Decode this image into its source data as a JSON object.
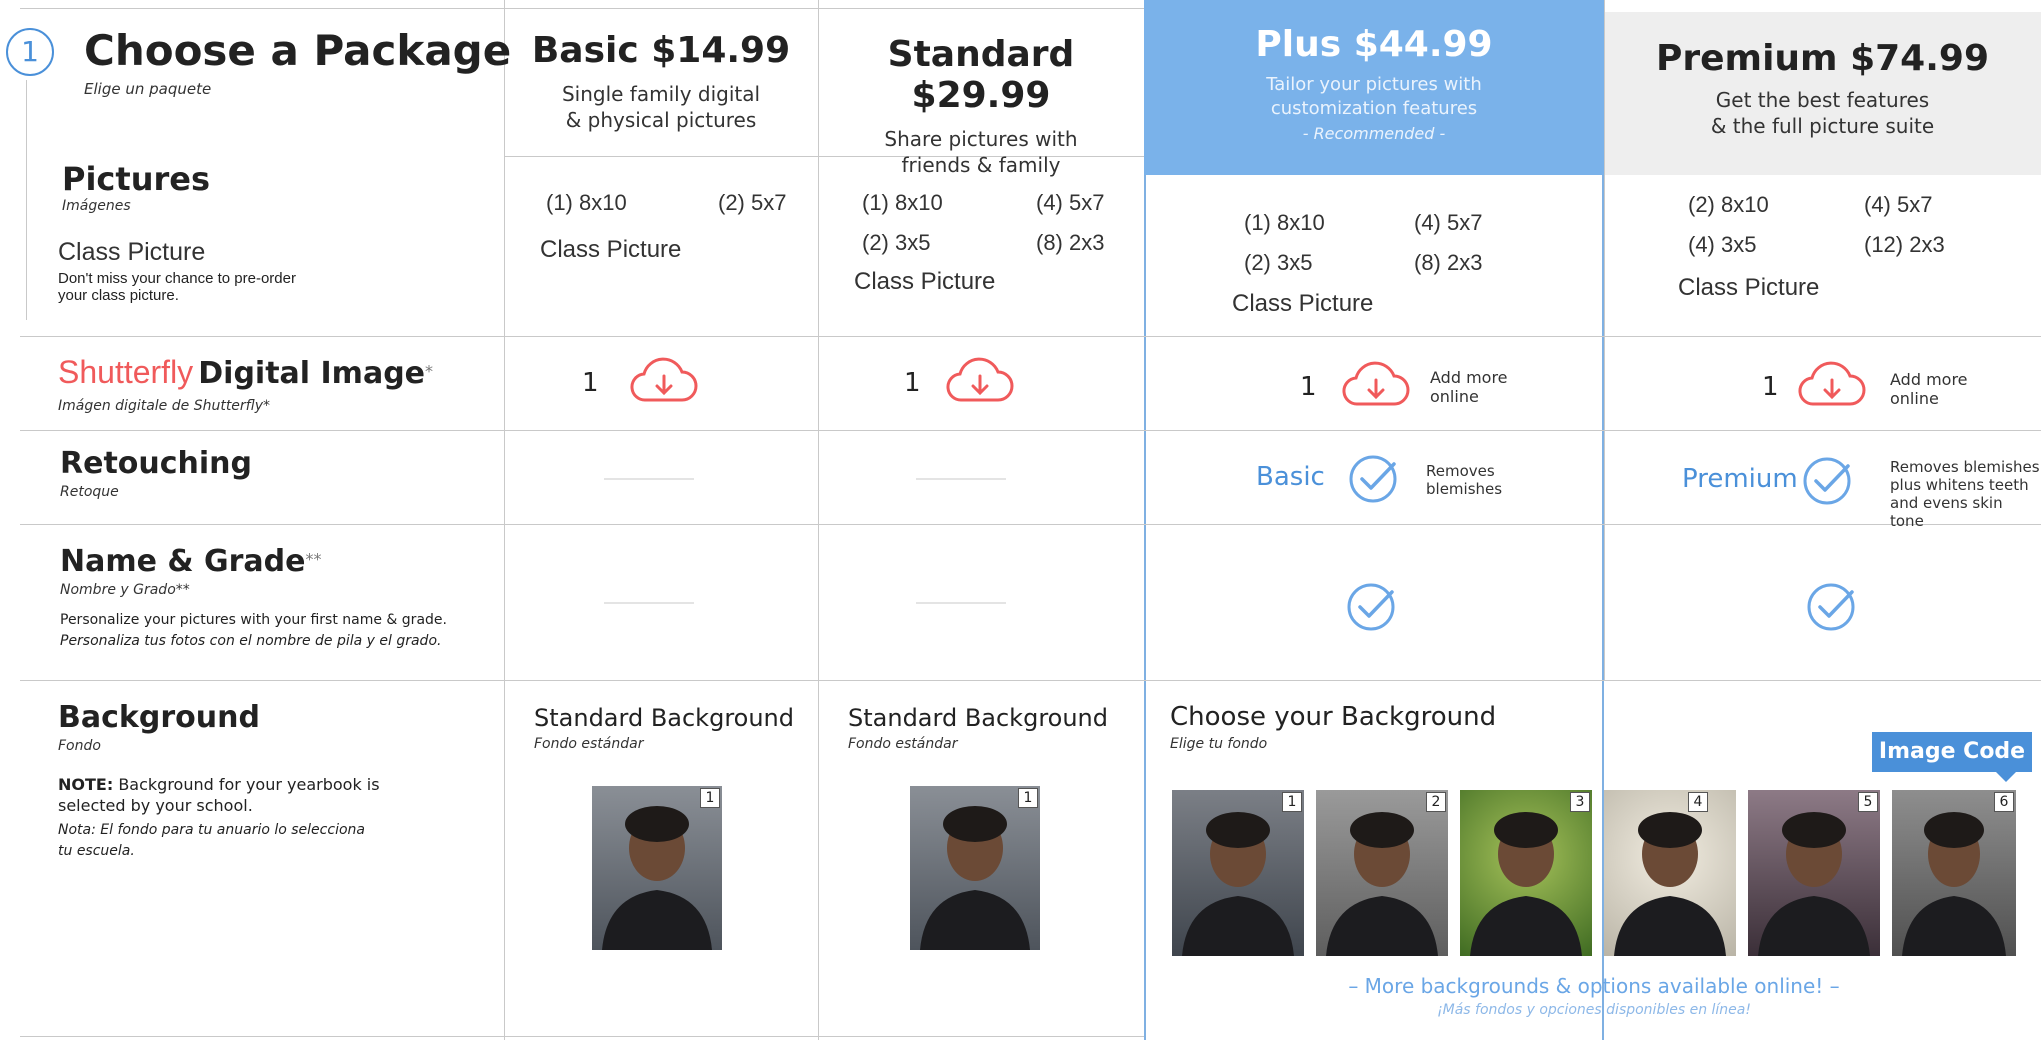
{
  "header": {
    "step_number": "1",
    "title": "Choose a Package",
    "subtitle": "Elige un paquete"
  },
  "packages": [
    {
      "title": "Basic $14.99",
      "desc1": "Single family digital",
      "desc2": "& physical pictures",
      "recommended": ""
    },
    {
      "title": "Standard $29.99",
      "desc1": "Share pictures with",
      "desc2": "friends & family",
      "recommended": ""
    },
    {
      "title": "Plus $44.99",
      "desc1": "Tailor your pictures with",
      "desc2": "customization features",
      "recommended": "- Recommended -"
    },
    {
      "title": "Premium $74.99",
      "desc1": "Get the best features",
      "desc2": "& the full picture suite",
      "recommended": ""
    }
  ],
  "pictures": {
    "title": "Pictures",
    "subtitle": "Imágenes",
    "class_title": "Class Picture",
    "class_desc1": "Don't miss your chance to pre-order",
    "class_desc2": "your class picture.",
    "basic": {
      "a": "(1) 8x10",
      "b": "(2) 5x7",
      "class": "Class Picture"
    },
    "standard": {
      "a": "(1) 8x10",
      "b": "(4) 5x7",
      "c": "(2) 3x5",
      "d": "(8) 2x3",
      "class": "Class Picture"
    },
    "plus": {
      "a": "(1) 8x10",
      "b": "(4) 5x7",
      "c": "(2) 3x5",
      "d": "(8) 2x3",
      "class": "Class Picture"
    },
    "premium": {
      "a": "(2) 8x10",
      "b": "(4) 5x7",
      "c": "(4) 3x5",
      "d": "(12) 2x3",
      "class": "Class Picture"
    }
  },
  "digital": {
    "brand": "Shutterfly",
    "title": "Digital Image",
    "star": "*",
    "subtitle": "Imágen digitale de Shutterfly*",
    "count_basic": "1",
    "count_standard": "1",
    "count_plus": "1",
    "count_premium": "1",
    "add_more_1": "Add more",
    "add_more_2": "online"
  },
  "retouching": {
    "title": "Retouching",
    "subtitle": "Retoque",
    "plus_label": "Basic",
    "plus_desc1": "Removes",
    "plus_desc2": "blemishes",
    "premium_label": "Premium",
    "premium_desc1": "Removes blemishes",
    "premium_desc2": "plus whitens teeth",
    "premium_desc3": "and evens skin tone"
  },
  "name_grade": {
    "title": "Name & Grade",
    "stars": "**",
    "subtitle": "Nombre y Grado**",
    "desc1": "Personalize your pictures with your first name & grade.",
    "desc2": "Personaliza tus fotos con el nombre de pila y el grado."
  },
  "background": {
    "title": "Background",
    "subtitle": "Fondo",
    "note_label": "NOTE:",
    "note1": " Background for your yearbook is",
    "note2": "selected by your school.",
    "nota1": "Nota: El fondo para tu anuario lo selecciona",
    "nota2": "tu escuela.",
    "standard_title": "Standard Background",
    "standard_sub": "Fondo estándar",
    "choose_title": "Choose your Background",
    "choose_sub": "Elige tu fondo",
    "image_code": "Image Code",
    "more_online": "– More backgrounds & options available online! –",
    "more_online_es": "¡Más fondos y opciones disponibles en línea!",
    "badges": [
      "1",
      "2",
      "3",
      "4",
      "5",
      "6"
    ]
  },
  "colors": {
    "accent_blue": "#4a90d9",
    "plus_header": "#7ab2ea",
    "shutterfly_red": "#f05a5b",
    "cloud_red": "#f05a5b",
    "check_blue": "#6aa6e6"
  },
  "icons": {
    "download": "cloud-download-icon",
    "check": "check-circle-icon"
  }
}
